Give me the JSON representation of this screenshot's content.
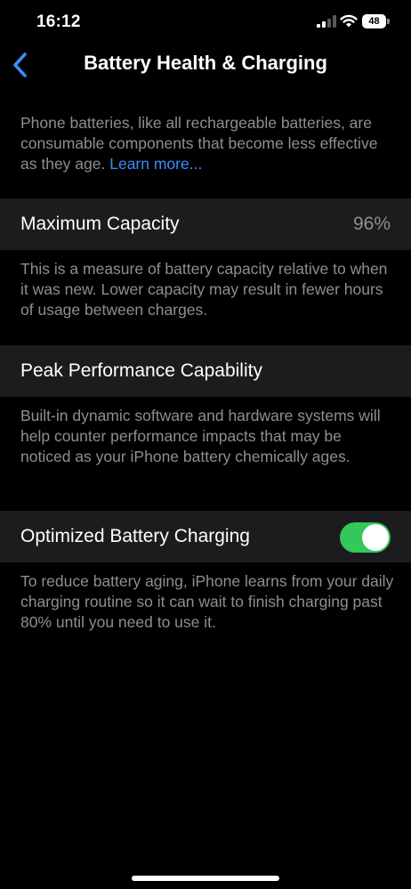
{
  "status_bar": {
    "time": "16:12",
    "battery_level": "48",
    "icons": [
      "signal-bars-icon",
      "wifi-icon",
      "battery-icon"
    ]
  },
  "nav": {
    "title": "Battery Health & Charging",
    "back_icon": "chevron-left-icon"
  },
  "intro": {
    "text": "Phone batteries, like all rechargeable batteries, are consumable components that become less effective as they age.",
    "link_label": "Learn more..."
  },
  "max_capacity": {
    "label": "Maximum Capacity",
    "value": "96%",
    "description": "This is a measure of battery capacity relative to when it was new. Lower capacity may result in fewer hours of usage between charges."
  },
  "peak_performance": {
    "label": "Peak Performance Capability",
    "description": "Built-in dynamic software and hardware systems will help counter performance impacts that may be noticed as your iPhone battery chemically ages."
  },
  "optimized_charging": {
    "label": "Optimized Battery Charging",
    "enabled": true,
    "description": "To reduce battery aging, iPhone learns from your daily charging routine so it can wait to finish charging past 80% until you need to use it."
  },
  "colors": {
    "background": "#000000",
    "cell_background": "#1c1c1e",
    "accent_blue": "#3d8bff",
    "toggle_on": "#34c759",
    "secondary_text": "#8e8e93"
  }
}
